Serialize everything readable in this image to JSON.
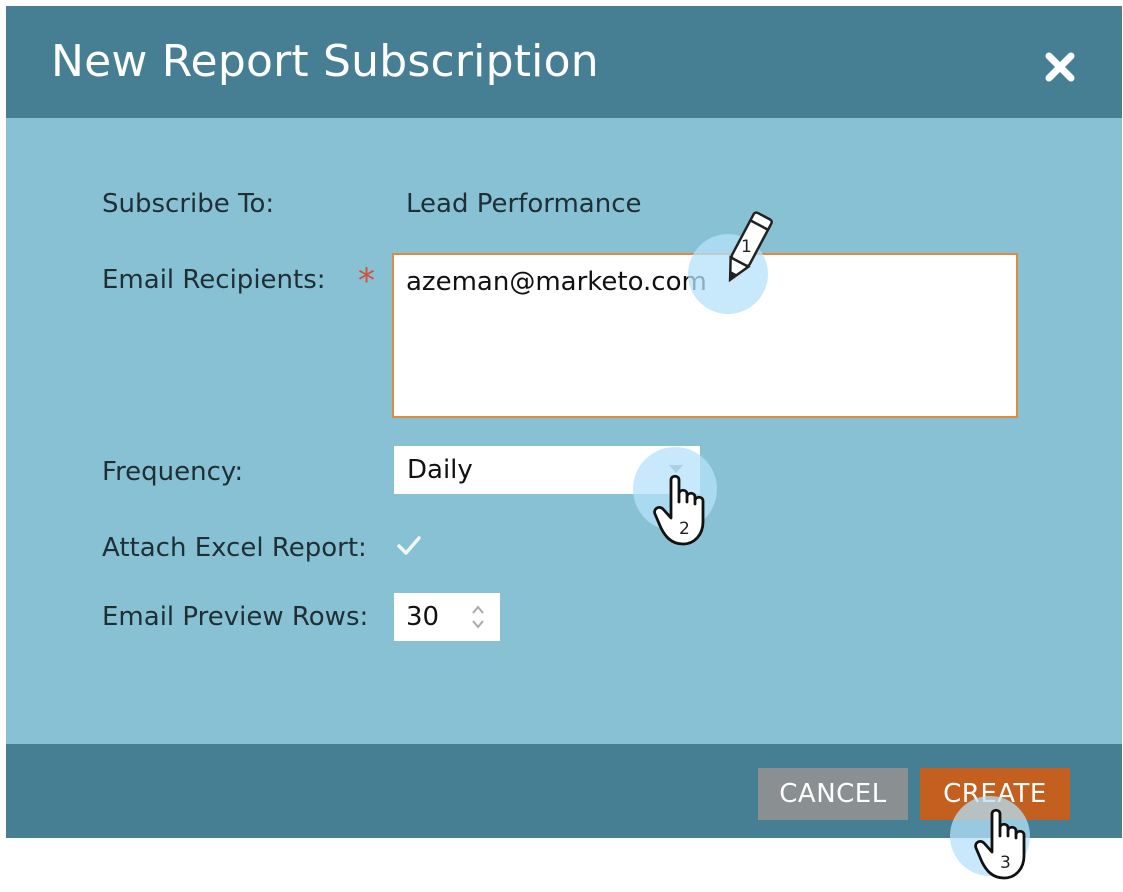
{
  "dialog": {
    "title": "New Report Subscription",
    "close_icon": "close-icon"
  },
  "form": {
    "subscribe_to": {
      "label": "Subscribe To:",
      "value": "Lead Performance"
    },
    "email_recipients": {
      "label": "Email Recipients:",
      "required_mark": "*",
      "value": "azeman@marketo.com"
    },
    "frequency": {
      "label": "Frequency:",
      "selected": "Daily"
    },
    "attach_excel": {
      "label": "Attach Excel Report:",
      "checked": true
    },
    "preview_rows": {
      "label": "Email Preview Rows:",
      "value": "30"
    }
  },
  "footer": {
    "cancel_label": "CANCEL",
    "create_label": "CREATE"
  },
  "callouts": {
    "step1": "1",
    "step2": "2",
    "step3": "3"
  },
  "colors": {
    "header": "#467f93",
    "body": "#88c1d3",
    "create": "#c35f1f",
    "cancel": "#8a8f92",
    "required": "#d0533b",
    "input_border": "#e08a3c"
  }
}
